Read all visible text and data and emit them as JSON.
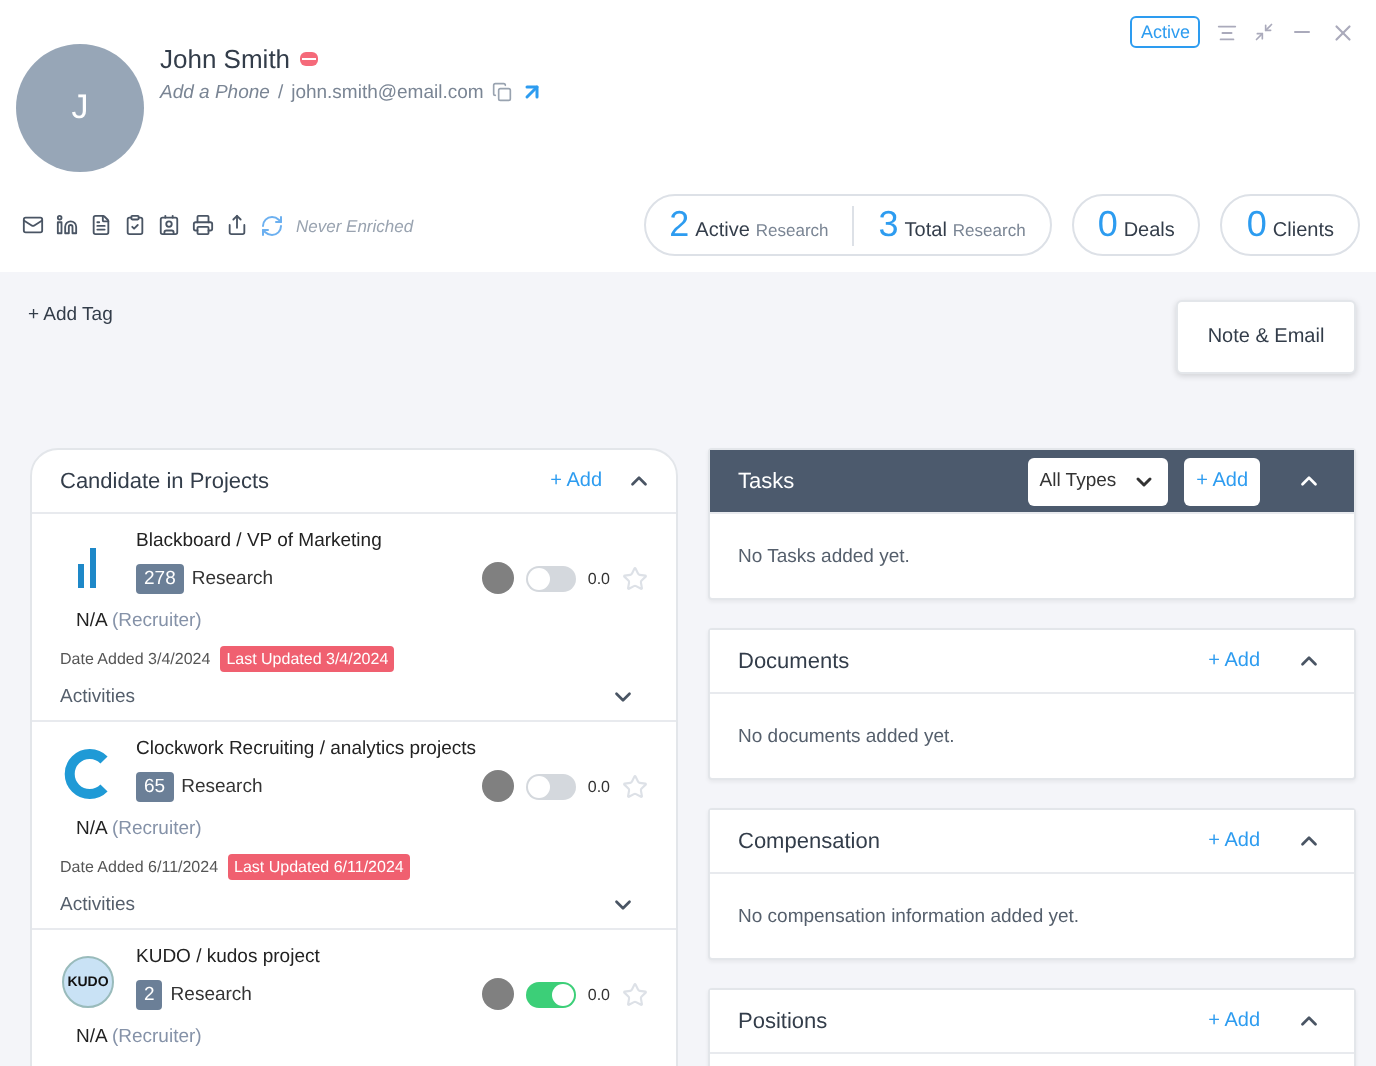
{
  "contact": {
    "initial": "J",
    "name": "John Smith",
    "phone_placeholder": "Add a Phone",
    "separator": "/",
    "email": "john.smith@email.com",
    "status": "Active",
    "enrichment": "Never Enriched"
  },
  "stats": [
    {
      "number": "2",
      "label": "Active",
      "sub": "Research",
      "kind": "grouped"
    },
    {
      "number": "3",
      "label": "Total",
      "sub": "Research",
      "kind": "grouped"
    },
    {
      "number": "0",
      "label": "Deals",
      "kind": "single"
    },
    {
      "number": "0",
      "label": "Clients",
      "kind": "single"
    }
  ],
  "add_tag": "+ Add Tag",
  "note_button": "Note & Email",
  "projects_panel": {
    "title": "Candidate in Projects",
    "add": "+ Add",
    "expanded": true,
    "projects": [
      {
        "kind": "bars",
        "title": "Blackboard / VP of Marketing",
        "count": "278",
        "stage": "Research",
        "on": false,
        "rating": "0.0",
        "favorite": false,
        "owner": "N/A",
        "role": "(Recruiter)",
        "date_added": "Date Added 3/4/2024",
        "last_updated": "Last Updated 3/4/2024",
        "activities": "Activities",
        "expanded": false
      },
      {
        "kind": "ring",
        "title": "Clockwork Recruiting / analytics projects",
        "count": "65",
        "stage": "Research",
        "on": false,
        "rating": "0.0",
        "favorite": false,
        "owner": "N/A",
        "role": "(Recruiter)",
        "date_added": "Date Added 6/11/2024",
        "last_updated": "Last Updated 6/11/2024",
        "activities": "Activities",
        "expanded": false
      },
      {
        "kind": "badge",
        "logo_text": "KUDO",
        "title": "KUDO / kudos project",
        "count": "2",
        "stage": "Research",
        "on": true,
        "rating": "0.0",
        "favorite": false,
        "owner": "N/A",
        "role": "(Recruiter)"
      }
    ]
  },
  "panels": [
    {
      "kind": "dark",
      "title": "Tasks",
      "filter": "All Types",
      "add": "+ Add",
      "expanded": true,
      "empty": "No Tasks added yet."
    },
    {
      "kind": "light",
      "title": "Documents",
      "add": "+ Add",
      "expanded": true,
      "empty": "No documents added yet."
    },
    {
      "kind": "light",
      "title": "Compensation",
      "add": "+ Add",
      "expanded": true,
      "empty": "No compensation information added yet."
    },
    {
      "kind": "light",
      "title": "Positions",
      "add": "+ Add",
      "expanded": true
    }
  ]
}
